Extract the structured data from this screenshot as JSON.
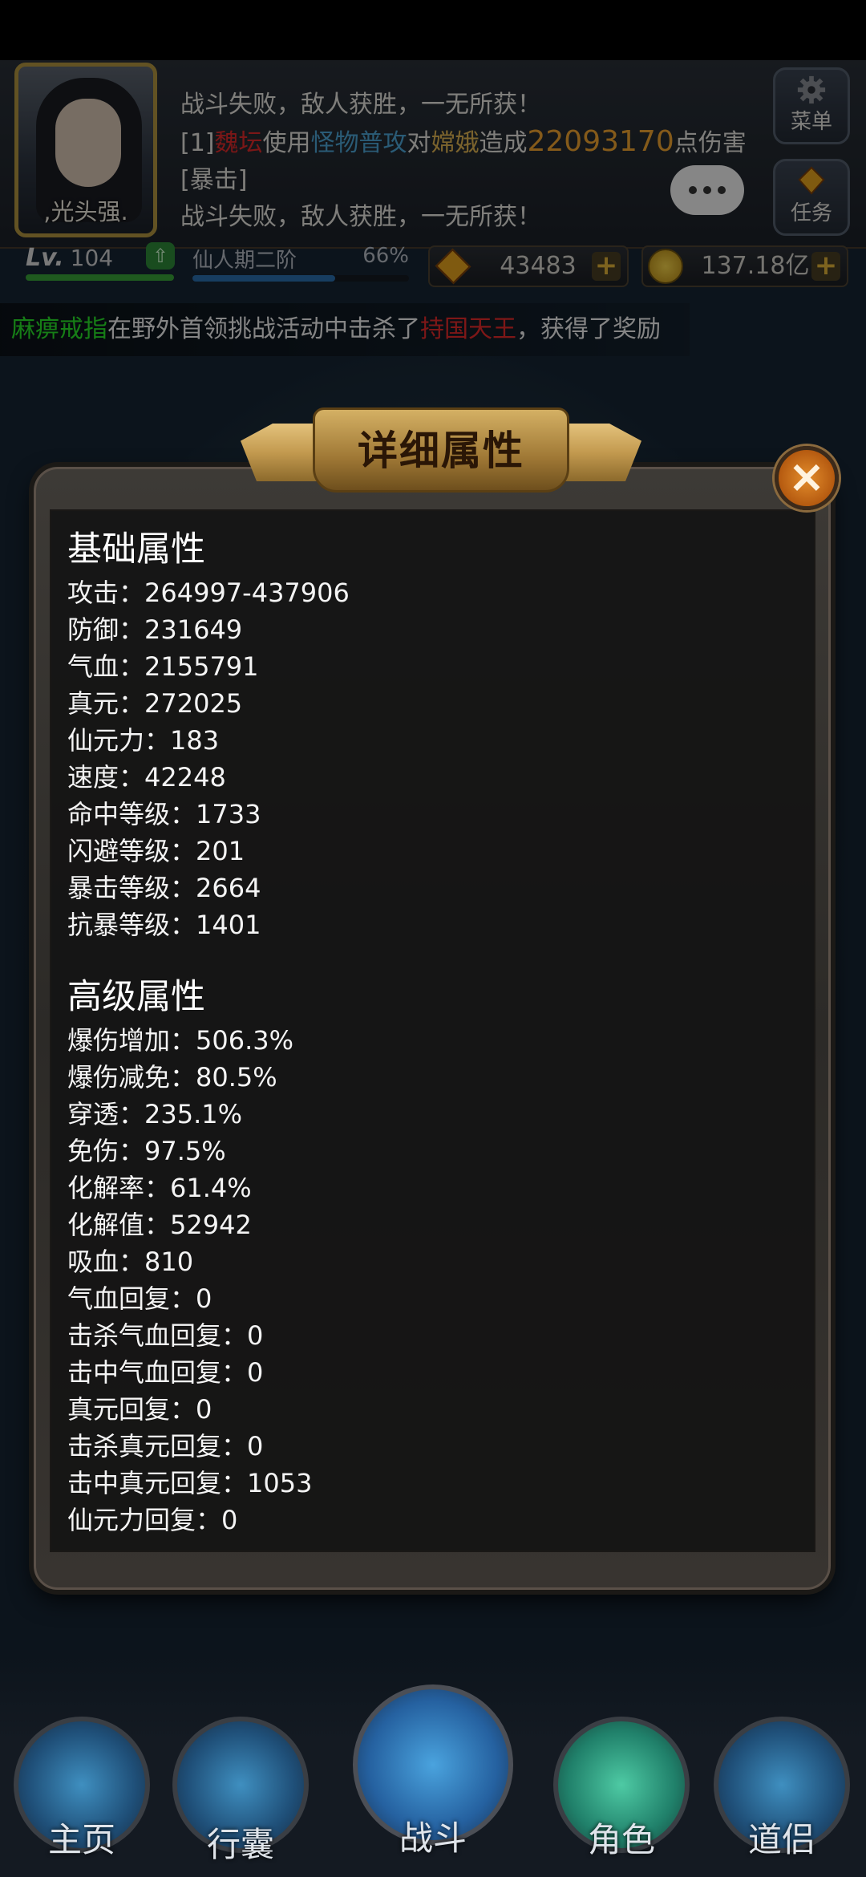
{
  "header": {
    "player_name": ",光头强.",
    "menu_label": "菜单",
    "task_label": "任务",
    "chat": {
      "line1": "战斗失败，敌人获胜，一无所获！",
      "line2_prefix": "[1]",
      "line2_actor": "魏坛",
      "line2_use": "使用",
      "line2_skill": "怪物普攻",
      "line2_on": "对",
      "line2_target": "嫦娥",
      "line2_cause": "造成",
      "line2_damage": "22093170",
      "line2_suffix": "点伤害[暴击]",
      "line3": "战斗失败，敌人获胜，一无所获！"
    },
    "level_label": "Lv.",
    "level": "104",
    "realm": "仙人期二阶",
    "realm_pct": "66%",
    "realm_progress": 0.66,
    "gems": "43483",
    "coins": "137.18亿"
  },
  "announcement": {
    "part1": "麻痹戒指",
    "part2": "在野外首领挑战活动中击杀了",
    "part3": "持国天王",
    "part4": "，获得了奖励"
  },
  "modal": {
    "title": "详细属性",
    "close_icon": "close-icon",
    "basic_title": "基础属性",
    "basic": [
      "攻击：264997-437906",
      "防御：231649",
      "气血：2155791",
      "真元：272025",
      "仙元力：183",
      "速度：42248",
      "命中等级：1733",
      "闪避等级：201",
      "暴击等级：2664",
      "抗暴等级：1401"
    ],
    "advanced_title": "高级属性",
    "advanced": [
      "爆伤增加：506.3%",
      "爆伤减免：80.5%",
      "穿透：235.1%",
      "免伤：97.5%",
      "化解率：61.4%",
      "化解值：52942",
      "吸血：810",
      "气血回复：0",
      "击杀气血回复：0",
      "击中气血回复：0",
      "真元回复：0",
      "击杀真元回复：0",
      "击中真元回复：1053",
      "仙元力回复：0"
    ]
  },
  "nav": {
    "home": "主页",
    "bag": "行囊",
    "battle": "战斗",
    "role": "角色",
    "companion": "道侣"
  }
}
